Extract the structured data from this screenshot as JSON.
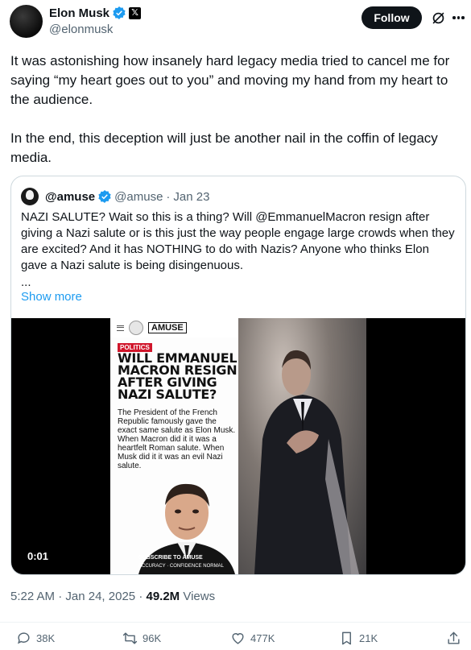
{
  "author": {
    "display_name": "Elon Musk",
    "handle": "@elonmusk",
    "verified": true,
    "affiliate_badge": "𝕏"
  },
  "header": {
    "follow_label": "Follow"
  },
  "tweet": {
    "paragraphs": [
      "It was astonishing how insanely hard legacy media tried to cancel me for saying “my heart goes out to you” and moving my hand from my heart to the audience.",
      "In the end, this deception will just be another nail in the coffin of legacy media."
    ]
  },
  "quote": {
    "display_name": "@amuse",
    "handle": "@amuse",
    "separator": "·",
    "date": "Jan 23",
    "text": "NAZI SALUTE? Wait so this is a thing? Will @EmmanuelMacron resign after giving a Nazi salute or is this just the way people engage large crowds when they are excited? And it has NOTHING to do with Nazis? Anyone who thinks Elon gave a Nazi salute is being disingenuous.",
    "ellipsis": "...",
    "show_more": "Show more",
    "media": {
      "brand": "AMUSE",
      "tag": "POLITICS",
      "headline": "WILL EMMANUEL MACRON RESIGN AFTER GIVING NAZI SALUTE?",
      "subtext": "The President of the French Republic famously gave the exact same salute as Elon Musk. When Macron did it it was a heartfelt Roman salute. When Musk did it it was an evil Nazi salute.",
      "subscribe": "SUBSCRIBE TO AMUSE",
      "accuracy": "ACCURACY · CONFIDENCE NORMAL",
      "duration": "0:01"
    }
  },
  "meta": {
    "time": "5:22 AM",
    "separator": "·",
    "date": "Jan 24, 2025",
    "views_count": "49.2M",
    "views_label": "Views"
  },
  "actions": {
    "replies": "38K",
    "reposts": "96K",
    "likes": "477K",
    "bookmarks": "21K"
  },
  "colors": {
    "accent": "#1d9bf0",
    "text": "#0f1419",
    "muted": "#536471",
    "border": "#cfd9de",
    "tag_red": "#d0162b"
  }
}
